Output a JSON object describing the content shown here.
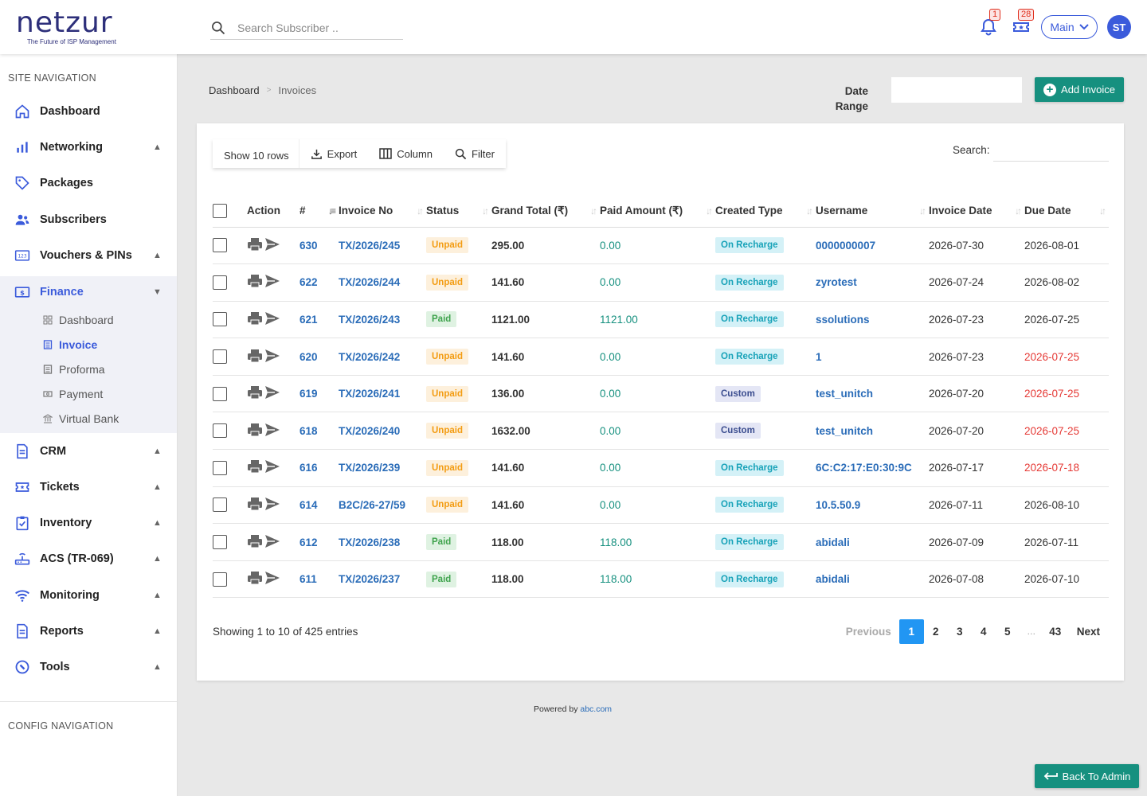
{
  "brand": {
    "name": "netzur",
    "tagline": "The Future of ISP Management"
  },
  "header": {
    "search_placeholder": "Search Subscriber ..",
    "notifications_count": "1",
    "tickets_count": "28",
    "workspace": "Main",
    "avatar_initials": "ST"
  },
  "sidebar": {
    "site_title": "SITE NAVIGATION",
    "config_title": "CONFIG NAVIGATION",
    "items": [
      {
        "label": "Dashboard"
      },
      {
        "label": "Networking"
      },
      {
        "label": "Packages"
      },
      {
        "label": "Subscribers"
      },
      {
        "label": "Vouchers & PINs"
      },
      {
        "label": "Finance"
      },
      {
        "label": "CRM"
      },
      {
        "label": "Tickets"
      },
      {
        "label": "Inventory"
      },
      {
        "label": "ACS (TR-069)"
      },
      {
        "label": "Monitoring"
      },
      {
        "label": "Reports"
      },
      {
        "label": "Tools"
      }
    ],
    "finance_sub": [
      {
        "label": "Dashboard"
      },
      {
        "label": "Invoice"
      },
      {
        "label": "Proforma"
      },
      {
        "label": "Payment"
      },
      {
        "label": "Virtual Bank"
      }
    ]
  },
  "breadcrumb": {
    "home": "Dashboard",
    "current": "Invoices"
  },
  "filters": {
    "date_range_label_1": "Date",
    "date_range_label_2": "Range",
    "add_invoice": "Add Invoice"
  },
  "toolbar": {
    "rows": "Show 10 rows",
    "export": "Export",
    "column": "Column",
    "filter": "Filter",
    "search_label": "Search:"
  },
  "table": {
    "columns": [
      "Action",
      "#",
      "Invoice No",
      "Status",
      "Grand Total (₹)",
      "Paid Amount (₹)",
      "Created Type",
      "Username",
      "Invoice Date",
      "Due Date"
    ],
    "rows": [
      {
        "id": "630",
        "invoice": "TX/2026/245",
        "status": "Unpaid",
        "total": "295.00",
        "paid": "0.00",
        "type": "On Recharge",
        "user": "0000000007",
        "inv_date": "2026-07-30",
        "due": "2026-08-01",
        "overdue": false
      },
      {
        "id": "622",
        "invoice": "TX/2026/244",
        "status": "Unpaid",
        "total": "141.60",
        "paid": "0.00",
        "type": "On Recharge",
        "user": "zyrotest",
        "inv_date": "2026-07-24",
        "due": "2026-08-02",
        "overdue": false
      },
      {
        "id": "621",
        "invoice": "TX/2026/243",
        "status": "Paid",
        "total": "1121.00",
        "paid": "1121.00",
        "type": "On Recharge",
        "user": "ssolutions",
        "inv_date": "2026-07-23",
        "due": "2026-07-25",
        "overdue": false
      },
      {
        "id": "620",
        "invoice": "TX/2026/242",
        "status": "Unpaid",
        "total": "141.60",
        "paid": "0.00",
        "type": "On Recharge",
        "user": "1",
        "inv_date": "2026-07-23",
        "due": "2026-07-25",
        "overdue": true
      },
      {
        "id": "619",
        "invoice": "TX/2026/241",
        "status": "Unpaid",
        "total": "136.00",
        "paid": "0.00",
        "type": "Custom",
        "user": "test_unitch",
        "inv_date": "2026-07-20",
        "due": "2026-07-25",
        "overdue": true
      },
      {
        "id": "618",
        "invoice": "TX/2026/240",
        "status": "Unpaid",
        "total": "1632.00",
        "paid": "0.00",
        "type": "Custom",
        "user": "test_unitch",
        "inv_date": "2026-07-20",
        "due": "2026-07-25",
        "overdue": true
      },
      {
        "id": "616",
        "invoice": "TX/2026/239",
        "status": "Unpaid",
        "total": "141.60",
        "paid": "0.00",
        "type": "On Recharge",
        "user": "6C:C2:17:E0:30:9C",
        "inv_date": "2026-07-17",
        "due": "2026-07-18",
        "overdue": true
      },
      {
        "id": "614",
        "invoice": "B2C/26-27/59",
        "status": "Unpaid",
        "total": "141.60",
        "paid": "0.00",
        "type": "On Recharge",
        "user": "10.5.50.9",
        "inv_date": "2026-07-11",
        "due": "2026-08-10",
        "overdue": false
      },
      {
        "id": "612",
        "invoice": "TX/2026/238",
        "status": "Paid",
        "total": "118.00",
        "paid": "118.00",
        "type": "On Recharge",
        "user": "abidali",
        "inv_date": "2026-07-09",
        "due": "2026-07-11",
        "overdue": false
      },
      {
        "id": "611",
        "invoice": "TX/2026/237",
        "status": "Paid",
        "total": "118.00",
        "paid": "118.00",
        "type": "On Recharge",
        "user": "abidali",
        "inv_date": "2026-07-08",
        "due": "2026-07-10",
        "overdue": false
      }
    ]
  },
  "pagination": {
    "info": "Showing 1 to 10 of 425 entries",
    "previous": "Previous",
    "pages": [
      "1",
      "2",
      "3",
      "4",
      "5",
      "…",
      "43"
    ],
    "current": "1",
    "next": "Next"
  },
  "footer": {
    "powered_by": "Powered by",
    "link": "abc.com",
    "back": "Back To Admin"
  },
  "colors": {
    "accent": "#3b5bdb",
    "teal": "#16907f",
    "link": "#2a6cb8",
    "danger": "#e53935"
  }
}
